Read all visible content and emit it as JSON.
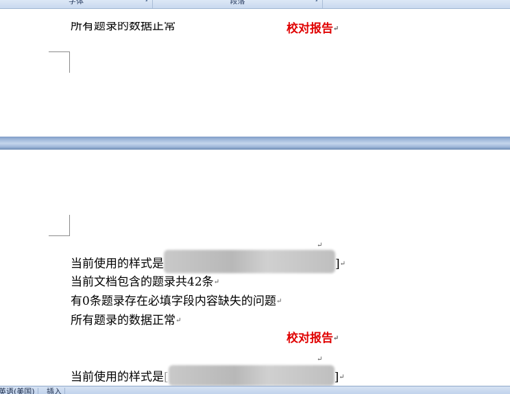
{
  "ribbon": {
    "groups": [
      {
        "label": "字体"
      },
      {
        "label": "段落"
      }
    ]
  },
  "page_top": {
    "cut_line": "所有题录的数据正常",
    "report_title": "校对报告"
  },
  "page_bottom": {
    "style_label": "当前使用的样式是",
    "style_bracket_end": "]",
    "count_line": "当前文档包含的题录共42条",
    "missing_line": "有0条题录存在必填字段内容缺失的问题",
    "normal_line": "所有题录的数据正常",
    "report_title": "校对报告",
    "style_label_2": "当前使用的样式是",
    "style_bracket_start_2": "[",
    "style_bracket_end_2": "]"
  },
  "status_bar": {
    "language": "英语(美国)",
    "mode": "插入"
  }
}
